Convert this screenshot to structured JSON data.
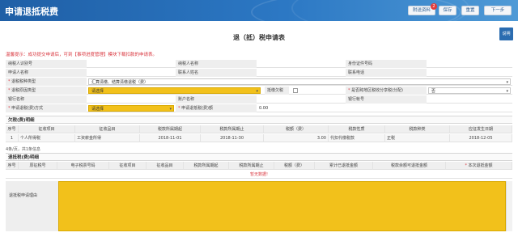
{
  "app": {
    "title": "申请退抵税费"
  },
  "toolbar": {
    "attach_label": "附送资料",
    "attach_badge": "2",
    "save_label": "保存",
    "reset_label": "重置",
    "next_label": "下一步"
  },
  "side_button": {
    "label": "说明"
  },
  "form": {
    "title": "退（抵）税申请表",
    "hint": "温馨提示：成功提交申请后，可到【事项进度管理】模块下载扣款的申请表。"
  },
  "fields": {
    "taxpayer_id_label": "纳税人识别号",
    "taxpayer_name_label": "纳税人名称",
    "id_type_label": "身份证件号码",
    "applicant_name_label": "申请人名称",
    "contact_person_label": "联系人姓名",
    "contact_phone_label": "联系电话",
    "refund_type_label": "退税税种类型",
    "refund_type_value": "汇算清缴、结算清缴退税（费）",
    "refund_reason_label": "退税原因类型",
    "refund_reason_value": "请选择",
    "offset_label": "抵缴欠税",
    "cross_region_label": "是否跨地区税收分享税(分配)",
    "cross_region_value": "否",
    "bank_name_label": "银行名称",
    "account_name_label": "账户名称",
    "bank_account_label": "银行帐号",
    "refund_method_label": "申请退税(费)方式",
    "refund_method_value": "请选择",
    "refund_amount_label": "申请退抵税(费)额",
    "refund_amount_value": "0.00"
  },
  "paid_section": {
    "title": "欠税(费)明细",
    "columns": [
      "序号",
      "征收项目",
      "征收品目",
      "税款所属期起",
      "税款所属期止",
      "税额（费）",
      "税款性质",
      "税款种类",
      "应征发生日期"
    ],
    "rows": [
      [
        "1",
        "个人所得税",
        "工资薪金所得",
        "2018-11-01",
        "2018-11-30",
        "3.00",
        "代扣代缴税款",
        "正税",
        "2018-12-05"
      ]
    ],
    "pager": "4条/页，共1条信息"
  },
  "refund_section": {
    "title": "退抵税(费)明细",
    "columns": [
      "序号",
      "原征税号",
      "电子税票号码",
      "征收项目",
      "征收品目",
      "税款所属期起",
      "税款所属期止",
      "税额（费）",
      "累计已退抵金额",
      "税款余额可退抵金额",
      "本次退抵金额"
    ],
    "empty_text": "暂无数据!"
  },
  "reason": {
    "label": "退抵税申请理由"
  }
}
